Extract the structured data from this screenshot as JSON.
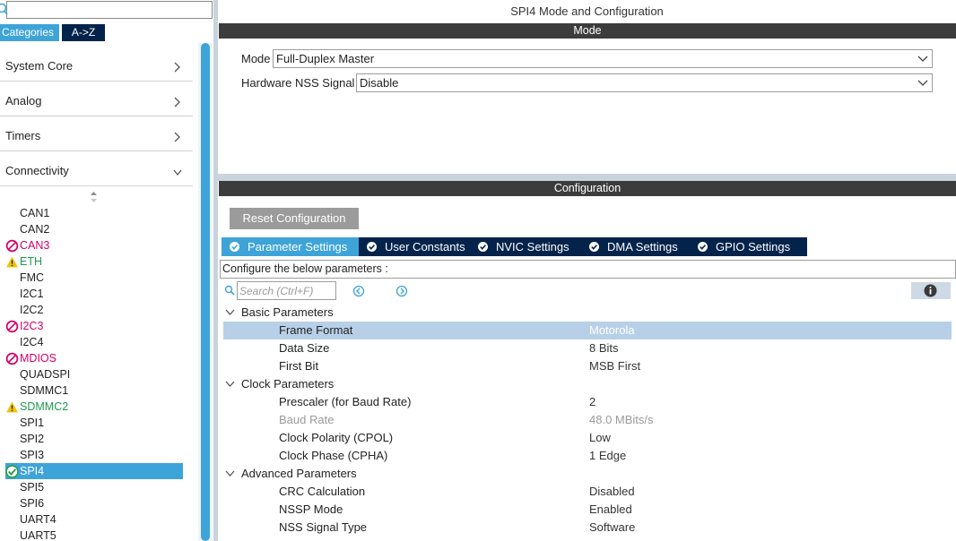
{
  "left_panel": {
    "search": {
      "value": "",
      "placeholder": ""
    },
    "tabs": {
      "categories": "Categories",
      "az": "A->Z"
    },
    "sections": [
      {
        "label": "System Core",
        "expanded": false
      },
      {
        "label": "Analog",
        "expanded": false
      },
      {
        "label": "Timers",
        "expanded": false
      },
      {
        "label": "Connectivity",
        "expanded": true
      }
    ],
    "peripherals": [
      {
        "label": "CAN1",
        "status": "none"
      },
      {
        "label": "CAN2",
        "status": "none"
      },
      {
        "label": "CAN3",
        "status": "error"
      },
      {
        "label": "ETH",
        "status": "warning"
      },
      {
        "label": "FMC",
        "status": "none"
      },
      {
        "label": "I2C1",
        "status": "none"
      },
      {
        "label": "I2C2",
        "status": "none"
      },
      {
        "label": "I2C3",
        "status": "error"
      },
      {
        "label": "I2C4",
        "status": "none"
      },
      {
        "label": "MDIOS",
        "status": "error"
      },
      {
        "label": "QUADSPI",
        "status": "none"
      },
      {
        "label": "SDMMC1",
        "status": "none"
      },
      {
        "label": "SDMMC2",
        "status": "warning"
      },
      {
        "label": "SPI1",
        "status": "none"
      },
      {
        "label": "SPI2",
        "status": "none"
      },
      {
        "label": "SPI3",
        "status": "none"
      },
      {
        "label": "SPI4",
        "status": "ok"
      },
      {
        "label": "SPI5",
        "status": "none"
      },
      {
        "label": "SPI6",
        "status": "none"
      },
      {
        "label": "UART4",
        "status": "none"
      },
      {
        "label": "UART5",
        "status": "none"
      }
    ]
  },
  "right_panel": {
    "title": "SPI4 Mode and Configuration",
    "mode_header": "Mode",
    "mode_label": "Mode",
    "mode_value": "Full-Duplex Master",
    "nss_label": "Hardware NSS Signal",
    "nss_value": "Disable",
    "config_header": "Configuration",
    "reset_label": "Reset Configuration",
    "tabs": [
      {
        "label": "Parameter Settings",
        "active": true
      },
      {
        "label": "User Constants",
        "active": false
      },
      {
        "label": "NVIC Settings",
        "active": false
      },
      {
        "label": "DMA Settings",
        "active": false
      },
      {
        "label": "GPIO Settings",
        "active": false
      }
    ],
    "description_text": "Configure the below parameters :",
    "search_placeholder": "Search (Ctrl+F)",
    "groups": [
      {
        "label": "Basic Parameters",
        "params": [
          {
            "name": "Frame Format",
            "value": "Motorola",
            "selected": true
          },
          {
            "name": "Data Size",
            "value": "8 Bits"
          },
          {
            "name": "First Bit",
            "value": "MSB First"
          }
        ]
      },
      {
        "label": "Clock Parameters",
        "params": [
          {
            "name": "Prescaler (for Baud Rate)",
            "value": "2"
          },
          {
            "name": "Baud Rate",
            "value": "48.0 MBits/s",
            "disabled": true
          },
          {
            "name": "Clock Polarity (CPOL)",
            "value": "Low"
          },
          {
            "name": "Clock Phase (CPHA)",
            "value": "1 Edge"
          }
        ]
      },
      {
        "label": "Advanced Parameters",
        "params": [
          {
            "name": "CRC Calculation",
            "value": "Disabled"
          },
          {
            "name": "NSSP Mode",
            "value": "Enabled"
          },
          {
            "name": "NSS Signal Type",
            "value": "Software"
          }
        ]
      }
    ]
  },
  "colors": {
    "accent": "#3ea4d8",
    "navy": "#03234b",
    "dark_header": "#3c3c3c",
    "error": "#d4006a",
    "warning": "#1f9a52",
    "selection": "#b8d0e7"
  },
  "icons": {
    "search": "search-icon",
    "chevron": "chevron-icon",
    "sort": "sort-arrows-icon",
    "error": "error-circle-icon",
    "warning": "warning-triangle-icon",
    "ok": "check-circle-icon",
    "info": "info-icon"
  }
}
